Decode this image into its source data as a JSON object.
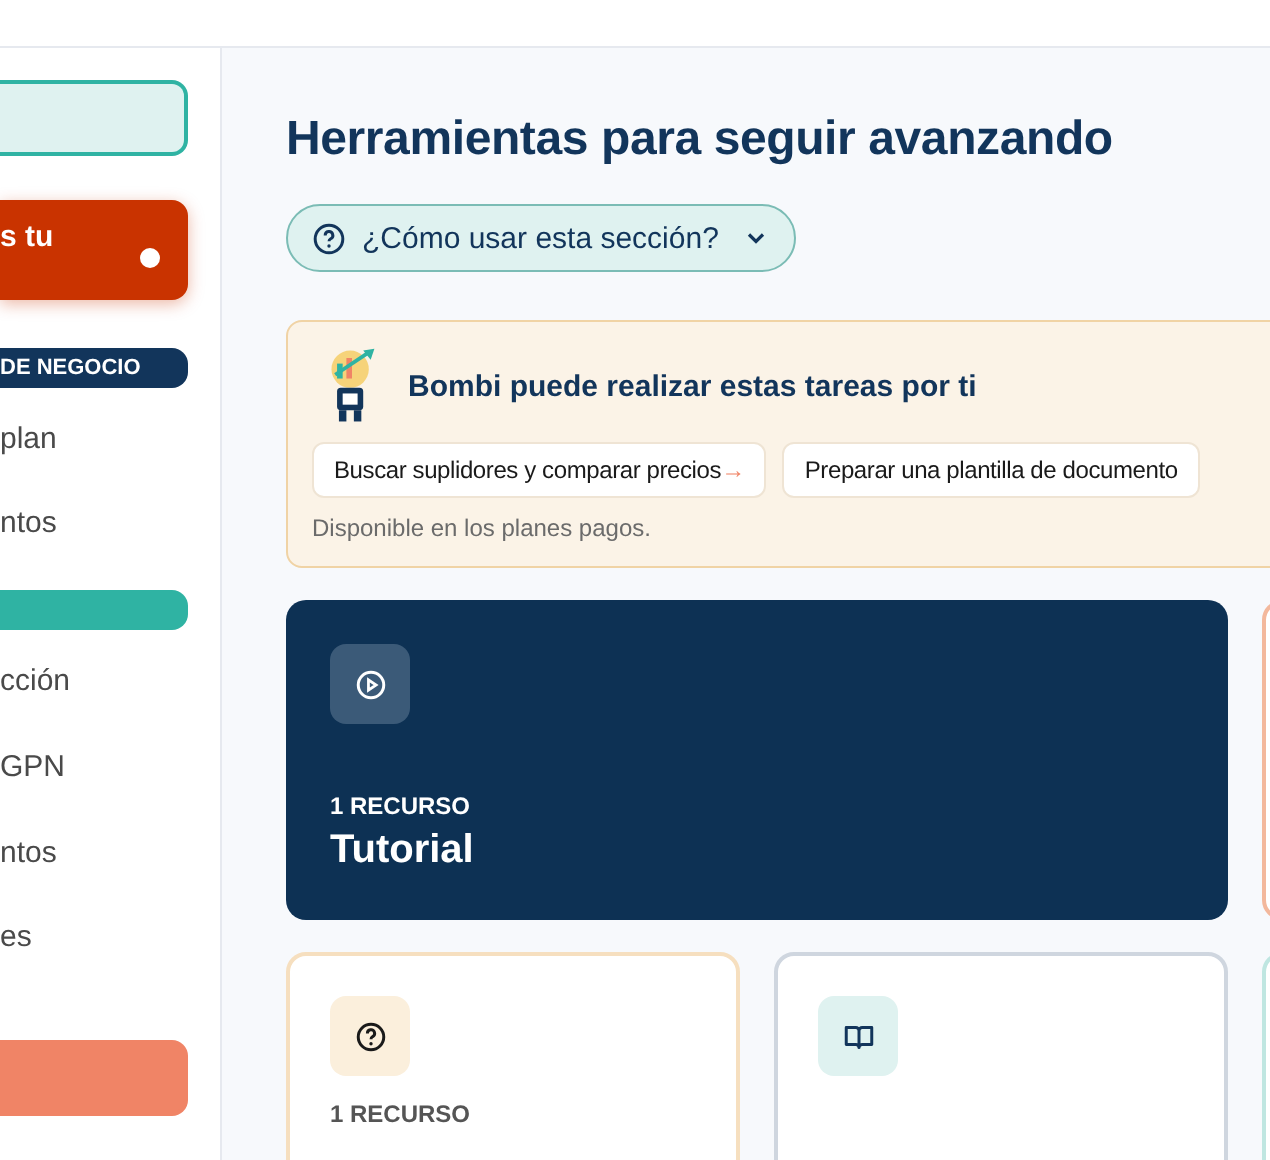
{
  "sidebar": {
    "items": [
      {
        "kind": "box",
        "color": "#dff2f0"
      },
      {
        "kind": "alert",
        "label": "s tu",
        "dot": true
      },
      {
        "kind": "section",
        "label": "DE NEGOCIO",
        "color": "#12355b"
      },
      {
        "kind": "link",
        "label": "plan"
      },
      {
        "kind": "link",
        "label": "ntos"
      },
      {
        "kind": "section",
        "color": "#2fb3a3"
      },
      {
        "kind": "link",
        "label": "cción"
      },
      {
        "kind": "link",
        "label": "GPN"
      },
      {
        "kind": "link",
        "label": "ntos"
      },
      {
        "kind": "link",
        "label": "es"
      },
      {
        "kind": "box",
        "color": "#f08466"
      }
    ]
  },
  "main": {
    "title": "Herramientas para seguir avanzando",
    "help": {
      "label": "¿Cómo usar esta sección?",
      "expanded": false
    },
    "assistant": {
      "title": "Bombi puede realizar estas tareas por ti",
      "tasks": [
        {
          "label": "Buscar suplidores y comparar precios",
          "arrow": "→"
        },
        {
          "label": "Preparar una plantilla de documento"
        }
      ],
      "note": "Disponible en los planes pagos."
    },
    "resources": [
      {
        "kind": "featured",
        "count": "1 RECURSO",
        "title": "Tutorial"
      },
      {
        "kind": "peek",
        "color": "#f3b89c"
      },
      {
        "kind": "faq",
        "color": "#f6dfbf",
        "count": "1 RECURSO"
      },
      {
        "kind": "guide",
        "color": "#cfd6df"
      },
      {
        "kind": "peek",
        "color": "#bfe6e1"
      }
    ]
  }
}
